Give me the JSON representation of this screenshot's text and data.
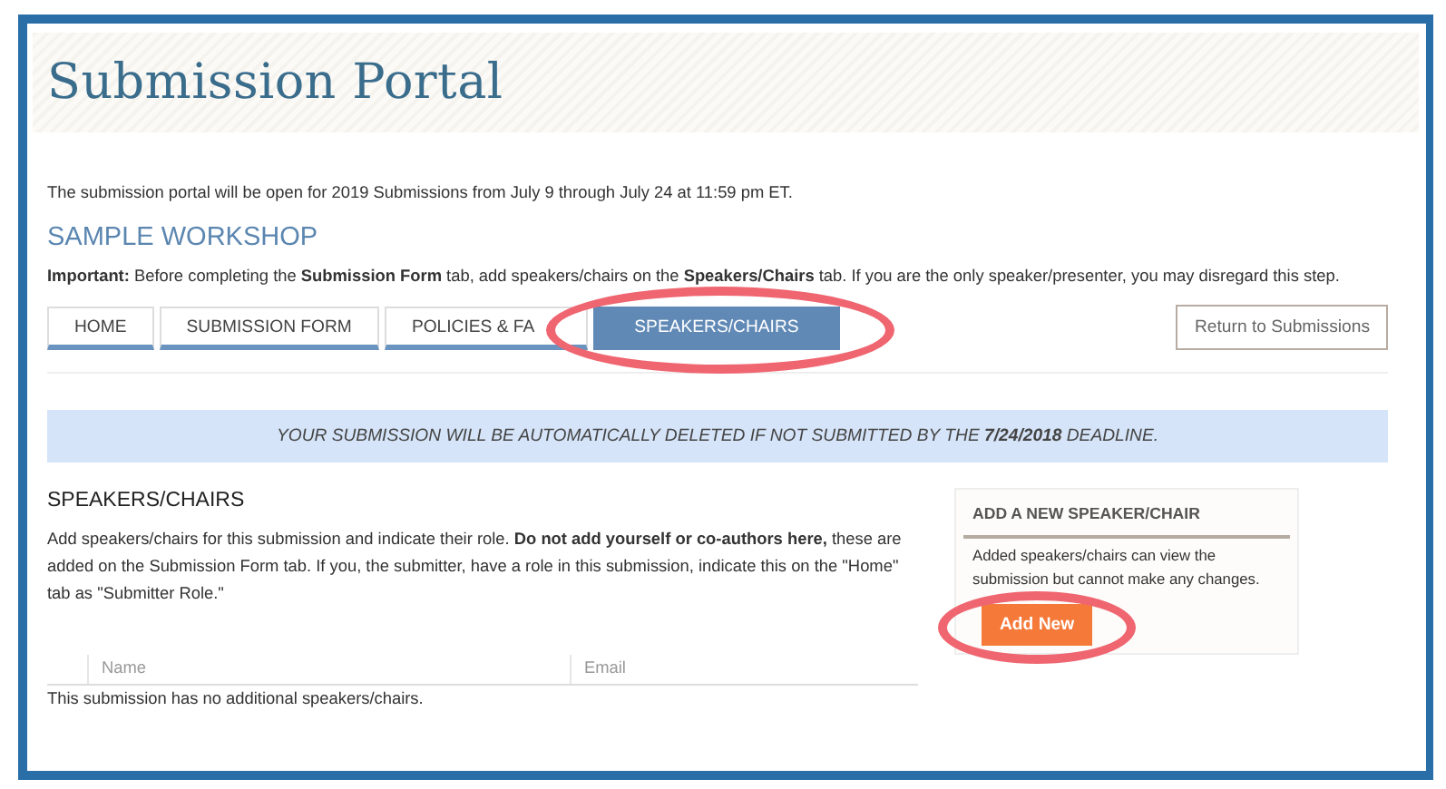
{
  "header": {
    "title": "Submission Portal"
  },
  "intro": "The submission portal will be open for 2019 Submissions from July 9 through July 24 at 11:59 pm ET.",
  "workshop_title": "SAMPLE WORKSHOP",
  "important": "**Important:** Before completing the **Submission Form** tab, add speakers/chairs on the **Speakers/Chairs** tab. If you are the only speaker/presenter, you may disregard this step.",
  "tabs": [
    {
      "label": "HOME",
      "selected": false,
      "circled": false
    },
    {
      "label": "SUBMISSION FORM",
      "selected": false,
      "circled": false
    },
    {
      "label": "POLICIES & FA",
      "selected": false,
      "circled": false
    },
    {
      "label": "SPEAKERS/CHAIRS",
      "selected": true,
      "circled": true
    }
  ],
  "return_button": "Return to Submissions",
  "notice": "YOUR SUBMISSION WILL BE AUTOMATICALLY DELETED IF NOT SUBMITTED BY THE **7/24/2018** DEADLINE.",
  "section": {
    "title": "SPEAKERS/CHAIRS",
    "description": "Add speakers/chairs for this submission and indicate their role. **Do not add yourself or co-authors here,** these are added on the Submission Form tab. If you, the submitter, have a role in this submission, indicate this on the \"Home\" tab as \"Submitter Role.\"",
    "table": {
      "columns": [
        "Name",
        "Email"
      ],
      "empty_message": "This submission has no additional speakers/chairs."
    }
  },
  "side_card": {
    "title": "ADD A NEW SPEAKER/CHAIR",
    "text": "Added speakers/chairs can view the submission but cannot make any changes.",
    "button": {
      "label": "Add New",
      "circled": true
    }
  }
}
